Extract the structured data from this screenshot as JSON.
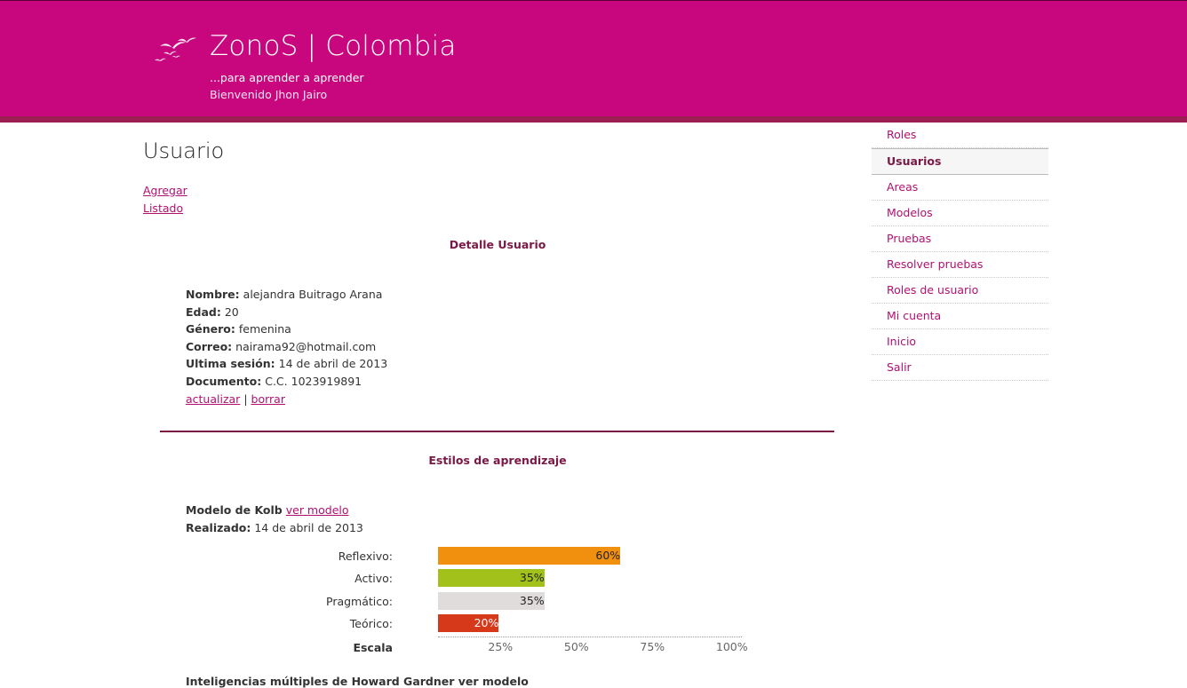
{
  "header": {
    "title": "ZonoS | Colombia",
    "tagline": "...para aprender a aprender",
    "welcome": "Bienvenido Jhon Jairo",
    "logo_icon": "birds-logo-icon",
    "bg_color": "#c8067e"
  },
  "main": {
    "page_title": "Usuario",
    "links": {
      "agregar": "Agregar",
      "listado": "Listado"
    },
    "detail_heading": "Detalle Usuario",
    "detail": {
      "nombre_label": "Nombre:",
      "nombre": "alejandra Buitrago Arana",
      "edad_label": "Edad:",
      "edad": "20",
      "genero_label": "Género:",
      "genero": "femenina",
      "correo_label": "Correo:",
      "correo": "nairama92@hotmail.com",
      "sesion_label": "Ultima sesión:",
      "sesion": "14 de abril de 2013",
      "documento_label": "Documento:",
      "documento": "C.C. 1023919891",
      "actualizar": "actualizar",
      "separator": "|",
      "borrar": "borrar"
    },
    "styles_heading": "Estilos de aprendizaje",
    "kolb": {
      "model_label": "Modelo de Kolb",
      "ver_modelo": "ver modelo",
      "realizado_label": "Realizado:",
      "realizado": "14 de abril de 2013"
    },
    "truncated_text": "Inteligencias múltiples de Howard Gardner ver modelo"
  },
  "chart_data": {
    "type": "bar",
    "orientation": "horizontal",
    "categories": [
      "Reflexivo:",
      "Activo:",
      "Pragmático:",
      "Teórico:"
    ],
    "values": [
      60,
      35,
      35,
      20
    ],
    "value_labels": [
      "60%",
      "35%",
      "35%",
      "20%"
    ],
    "colors": [
      "#f0900e",
      "#a2c11b",
      "#e0dcdc",
      "#d5391a"
    ],
    "label_colors": [
      "#222222",
      "#222222",
      "#222222",
      "#ffffff"
    ],
    "axis_label": "Escala",
    "ticks": [
      "25%",
      "50%",
      "75%",
      "100%"
    ],
    "tick_values": [
      20,
      45,
      70,
      95
    ],
    "xlim": [
      0,
      100
    ]
  },
  "sidebar": {
    "items": [
      {
        "label": "Roles"
      },
      {
        "label": "Usuarios",
        "active": true
      },
      {
        "label": "Areas"
      },
      {
        "label": "Modelos"
      },
      {
        "label": "Pruebas"
      },
      {
        "label": "Resolver pruebas"
      },
      {
        "label": "Roles de usuario"
      },
      {
        "label": "Mi cuenta"
      },
      {
        "label": "Inicio"
      },
      {
        "label": "Salir"
      }
    ]
  }
}
